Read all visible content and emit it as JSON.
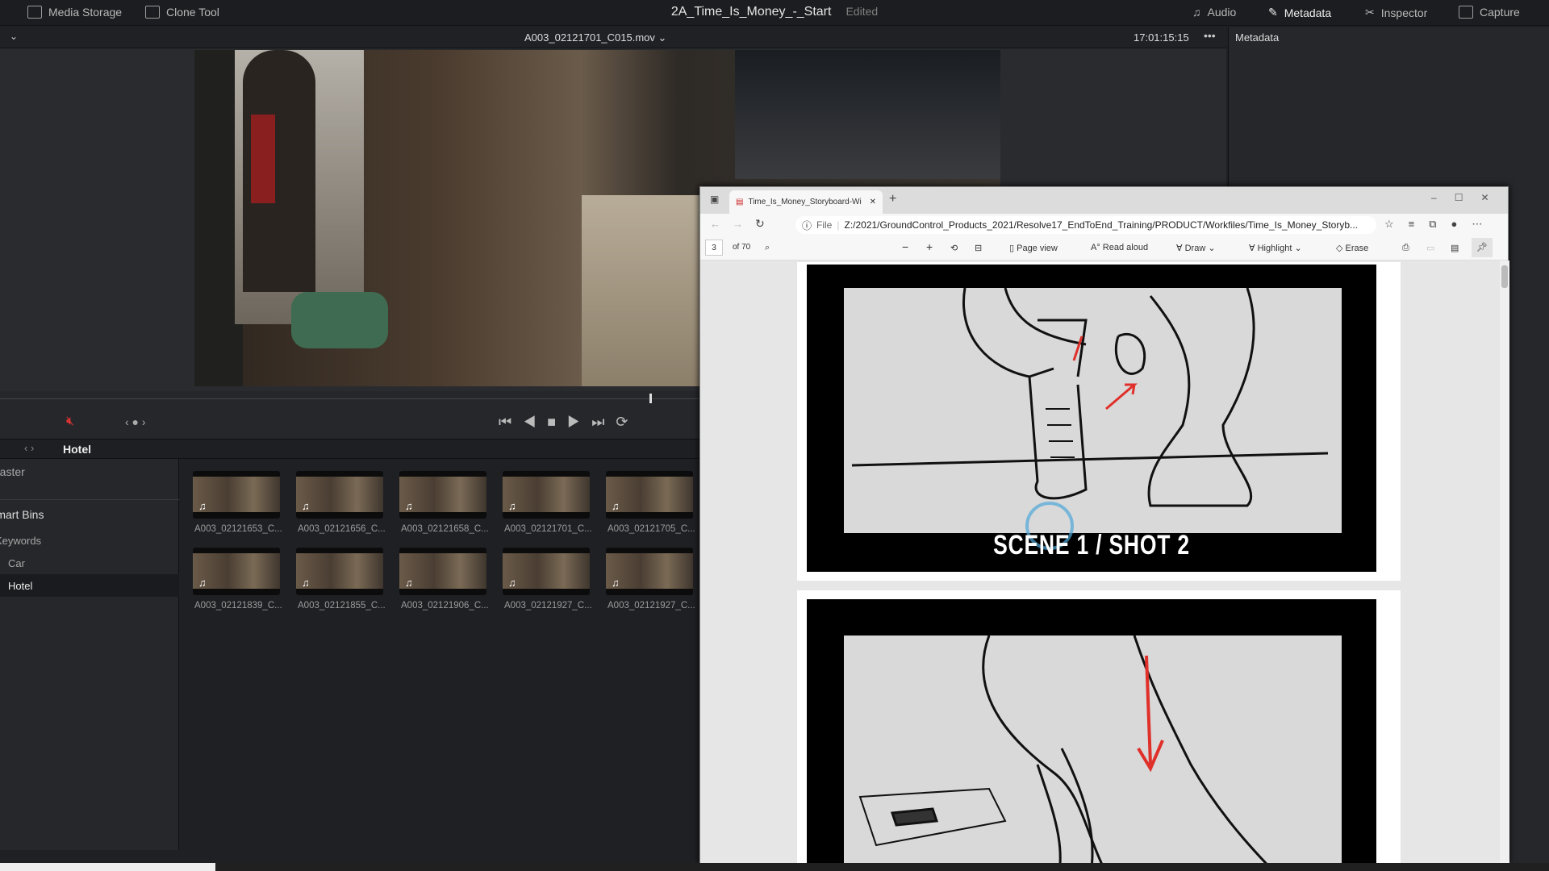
{
  "topbar": {
    "media_storage": "Media Storage",
    "clone_tool": "Clone Tool",
    "project_title": "2A_Time_Is_Money_-_Start",
    "status": "Edited",
    "audio": "Audio",
    "metadata": "Metadata",
    "inspector": "Inspector",
    "capture": "Capture"
  },
  "viewer": {
    "clip_name": "A003_02121701_C015.mov",
    "timecode": "17:01:15:15"
  },
  "metadata_panel": {
    "title": "Metadata"
  },
  "bin": {
    "current": "Hotel"
  },
  "sidebar": {
    "items": [
      "Master",
      "Smart Bins",
      "Keywords",
      "Car",
      "Hotel"
    ]
  },
  "clips": [
    "A003_02121653_C...",
    "A003_02121656_C...",
    "A003_02121658_C...",
    "A003_02121701_C...",
    "A003_02121705_C...",
    "A003_02121839_C...",
    "A003_02121855_C...",
    "A003_02121906_C...",
    "A003_02121927_C...",
    "A003_02121927_C..."
  ],
  "browser": {
    "tab_title": "Time_Is_Money_Storyboard-Wi",
    "url_prefix": "File",
    "url": "Z:/2021/GroundControl_Products_2021/Resolve17_EndToEnd_Training/PRODUCT/Workfiles/Time_Is_Money_Storyb...",
    "page": "3",
    "page_total": "of 70",
    "page_view": "Page view",
    "read_aloud": "Read aloud",
    "draw": "Draw",
    "highlight": "Highlight",
    "erase": "Erase"
  },
  "pdf": {
    "caption": "SCENE 1 / SHOT 2"
  },
  "colors": {
    "mute_red": "#d33",
    "arrow_red": "#e0302a"
  }
}
